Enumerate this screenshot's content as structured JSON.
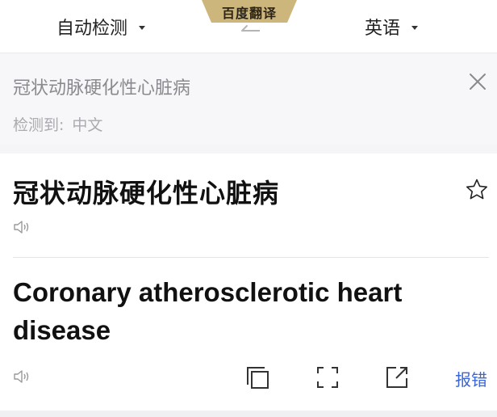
{
  "header": {
    "brand": "百度翻译",
    "source_lang": "自动检测",
    "target_lang": "英语",
    "icons": {
      "caret": "chevron-down-icon",
      "swap": "swap-arrows-icon"
    }
  },
  "input": {
    "text": "冠状动脉硬化性心脏病",
    "detect_label": "检测到:",
    "detect_value": "中文",
    "icons": {
      "clear": "close-icon"
    }
  },
  "result": {
    "source_word": "冠状动脉硬化性心脏病",
    "translation": "Coronary atherosclerotic heart disease",
    "report_label": "报错",
    "icons": {
      "favorite": "star-icon",
      "speak": "speaker-icon",
      "copy": "copy-icon",
      "fullscreen": "fullscreen-icon",
      "share": "share-icon"
    }
  },
  "colors": {
    "brand_gold": "#cdb67c",
    "link_blue": "#3a66d9",
    "muted_text": "#8a8a8e"
  }
}
